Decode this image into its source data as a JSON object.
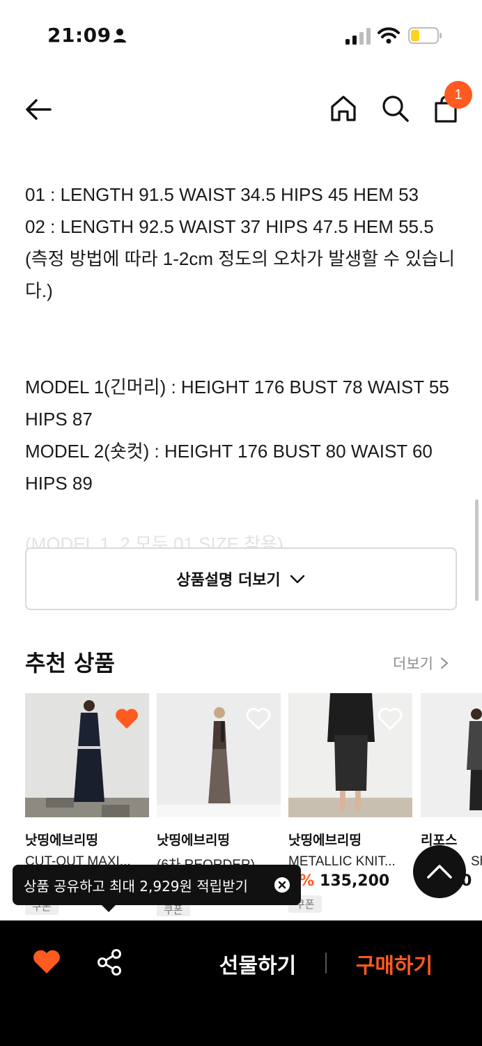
{
  "status_bar": {
    "time": "21:09"
  },
  "nav": {
    "cart_count": "1"
  },
  "description": {
    "lines": [
      "01 : LENGTH 91.5 WAIST 34.5 HIPS 45 HEM 53",
      "02 : LENGTH 92.5 WAIST 37 HIPS 47.5 HEM 55.5",
      "(측정 방법에 따라 1-2cm 정도의 오차가 발생할 수 있습니다.)",
      "MODEL 1(긴머리) : HEIGHT 176 BUST 78 WAIST 55 HIPS 87",
      "MODEL 2(숏컷) : HEIGHT 176 BUST 80 WAIST 60 HIPS 89"
    ],
    "faded_line": "(MODEL 1, 2 모두 01 SIZE 착용)",
    "more_label": "상품설명 더보기"
  },
  "recommend": {
    "title": "추천 상품",
    "more_label": "더보기",
    "items": [
      {
        "brand": "낫띵에브리띵",
        "name": "CUT-OUT MAXI...",
        "discount": "",
        "price": "",
        "coupon": "쿠폰",
        "liked": true
      },
      {
        "brand": "낫띵에브리띵",
        "name": "(6차 REORDER) ...",
        "discount": "",
        "price": "",
        "coupon": "쿠폰",
        "liked": false
      },
      {
        "brand": "낫띵에브리띵",
        "name": "METALLIC KNIT...",
        "discount": "0%",
        "price": "135,200",
        "coupon": "쿠폰",
        "liked": false
      },
      {
        "brand": "리포스",
        "name": "Sh",
        "discount": "",
        "price": "0",
        "coupon": "",
        "liked": false
      }
    ]
  },
  "tooltip": {
    "text": "상품 공유하고 최대 2,929원 적립받기"
  },
  "bottom_bar": {
    "gift_label": "선물하기",
    "buy_label": "구매하기"
  },
  "colors": {
    "accent": "#ff5a1f",
    "bar": "#000000"
  }
}
